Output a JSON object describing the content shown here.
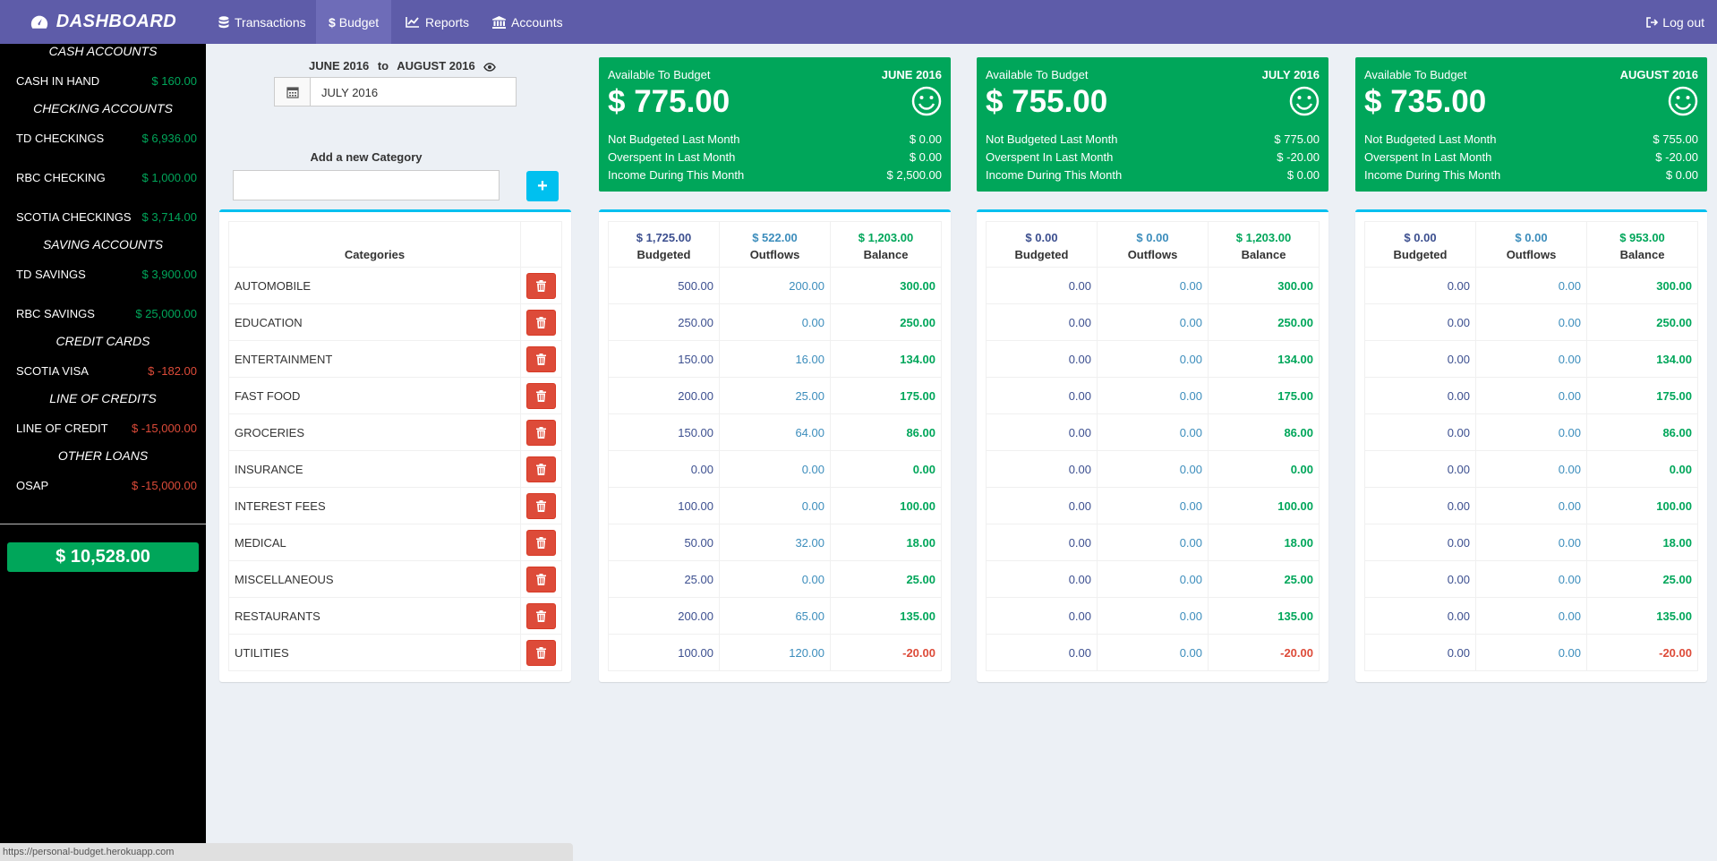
{
  "nav": {
    "brand": "DASHBOARD",
    "items": [
      {
        "label": "Transactions",
        "icon": "database-icon"
      },
      {
        "label": "Budget",
        "icon": "dollar-icon"
      },
      {
        "label": "Reports",
        "icon": "line-chart-icon"
      },
      {
        "label": "Accounts",
        "icon": "bank-icon"
      }
    ],
    "logout": "Log out"
  },
  "sidebar": {
    "sections": [
      {
        "title": "CASH ACCOUNTS",
        "accounts": [
          {
            "name": "CASH IN HAND",
            "amount": "$ 160.00",
            "status": "positive"
          }
        ]
      },
      {
        "title": "CHECKING ACCOUNTS",
        "accounts": [
          {
            "name": "TD CHECKINGS",
            "amount": "$ 6,936.00",
            "status": "positive"
          },
          {
            "name": "RBC CHECKING",
            "amount": "$ 1,000.00",
            "status": "positive"
          },
          {
            "name": "SCOTIA CHECKINGS",
            "amount": "$ 3,714.00",
            "status": "positive"
          }
        ]
      },
      {
        "title": "SAVING ACCOUNTS",
        "accounts": [
          {
            "name": "TD SAVINGS",
            "amount": "$ 3,900.00",
            "status": "positive"
          },
          {
            "name": "RBC SAVINGS",
            "amount": "$ 25,000.00",
            "status": "positive"
          }
        ]
      },
      {
        "title": "CREDIT CARDS",
        "accounts": [
          {
            "name": "SCOTIA VISA",
            "amount": "$ -182.00",
            "status": "negative"
          }
        ]
      },
      {
        "title": "LINE OF CREDITS",
        "accounts": [
          {
            "name": "LINE OF CREDIT",
            "amount": "$ -15,000.00",
            "status": "negative"
          }
        ]
      },
      {
        "title": "OTHER LOANS",
        "accounts": [
          {
            "name": "OSAP",
            "amount": "$ -15,000.00",
            "status": "negative"
          }
        ]
      }
    ],
    "total": "$ 10,528.00"
  },
  "status_url": "https://personal-budget.herokuapp.com",
  "range": {
    "from": "JUNE 2016",
    "sep": "to",
    "to": "AUGUST 2016"
  },
  "date_value": "JULY 2016",
  "add_category": {
    "label": "Add a new Category",
    "value": "",
    "button": "+"
  },
  "categories_header": "Categories",
  "categories": [
    "AUTOMOBILE",
    "EDUCATION",
    "ENTERTAINMENT",
    "FAST FOOD",
    "GROCERIES",
    "INSURANCE",
    "INTEREST FEES",
    "MEDICAL",
    "MISCELLANEOUS",
    "RESTAURANTS",
    "UTILITIES"
  ],
  "column_labels": {
    "budgeted": "Budgeted",
    "outflows": "Outflows",
    "balance": "Balance"
  },
  "months": [
    {
      "month": "JUNE 2016",
      "available_label": "Available To Budget",
      "available": "$ 775.00",
      "stats": [
        {
          "label": "Not Budgeted Last Month",
          "value": "$ 0.00"
        },
        {
          "label": "Overspent In Last Month",
          "value": "$ 0.00"
        },
        {
          "label": "Income During This Month",
          "value": "$ 2,500.00"
        }
      ],
      "totals": {
        "budgeted": "$ 1,725.00",
        "outflows": "$ 522.00",
        "balance": "$ 1,203.00"
      },
      "rows": [
        [
          "500.00",
          "200.00",
          "300.00"
        ],
        [
          "250.00",
          "0.00",
          "250.00"
        ],
        [
          "150.00",
          "16.00",
          "134.00"
        ],
        [
          "200.00",
          "25.00",
          "175.00"
        ],
        [
          "150.00",
          "64.00",
          "86.00"
        ],
        [
          "0.00",
          "0.00",
          "0.00"
        ],
        [
          "100.00",
          "0.00",
          "100.00"
        ],
        [
          "50.00",
          "32.00",
          "18.00"
        ],
        [
          "25.00",
          "0.00",
          "25.00"
        ],
        [
          "200.00",
          "65.00",
          "135.00"
        ],
        [
          "100.00",
          "120.00",
          "-20.00"
        ]
      ]
    },
    {
      "month": "JULY 2016",
      "available_label": "Available To Budget",
      "available": "$ 755.00",
      "stats": [
        {
          "label": "Not Budgeted Last Month",
          "value": "$ 775.00"
        },
        {
          "label": "Overspent In Last Month",
          "value": "$ -20.00"
        },
        {
          "label": "Income During This Month",
          "value": "$ 0.00"
        }
      ],
      "totals": {
        "budgeted": "$ 0.00",
        "outflows": "$ 0.00",
        "balance": "$ 1,203.00"
      },
      "rows": [
        [
          "0.00",
          "0.00",
          "300.00"
        ],
        [
          "0.00",
          "0.00",
          "250.00"
        ],
        [
          "0.00",
          "0.00",
          "134.00"
        ],
        [
          "0.00",
          "0.00",
          "175.00"
        ],
        [
          "0.00",
          "0.00",
          "86.00"
        ],
        [
          "0.00",
          "0.00",
          "0.00"
        ],
        [
          "0.00",
          "0.00",
          "100.00"
        ],
        [
          "0.00",
          "0.00",
          "18.00"
        ],
        [
          "0.00",
          "0.00",
          "25.00"
        ],
        [
          "0.00",
          "0.00",
          "135.00"
        ],
        [
          "0.00",
          "0.00",
          "-20.00"
        ]
      ]
    },
    {
      "month": "AUGUST 2016",
      "available_label": "Available To Budget",
      "available": "$ 735.00",
      "stats": [
        {
          "label": "Not Budgeted Last Month",
          "value": "$ 755.00"
        },
        {
          "label": "Overspent In Last Month",
          "value": "$ -20.00"
        },
        {
          "label": "Income During This Month",
          "value": "$ 0.00"
        }
      ],
      "totals": {
        "budgeted": "$ 0.00",
        "outflows": "$ 0.00",
        "balance": "$ 953.00"
      },
      "rows": [
        [
          "0.00",
          "0.00",
          "300.00"
        ],
        [
          "0.00",
          "0.00",
          "250.00"
        ],
        [
          "0.00",
          "0.00",
          "134.00"
        ],
        [
          "0.00",
          "0.00",
          "175.00"
        ],
        [
          "0.00",
          "0.00",
          "86.00"
        ],
        [
          "0.00",
          "0.00",
          "0.00"
        ],
        [
          "0.00",
          "0.00",
          "100.00"
        ],
        [
          "0.00",
          "0.00",
          "18.00"
        ],
        [
          "0.00",
          "0.00",
          "25.00"
        ],
        [
          "0.00",
          "0.00",
          "135.00"
        ],
        [
          "0.00",
          "0.00",
          "-20.00"
        ]
      ]
    }
  ],
  "colors": {
    "nav": "#5e5ca9",
    "green": "#00a65a",
    "red": "#dd4b39",
    "info": "#00c0ef"
  }
}
